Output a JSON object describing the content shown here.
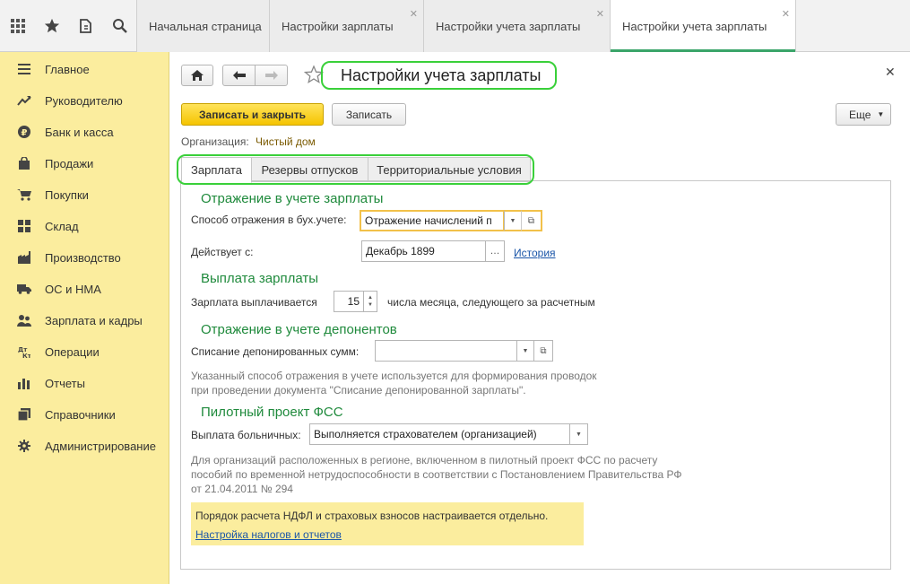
{
  "tabs": [
    {
      "label": "Начальная страница",
      "closable": false,
      "active": false
    },
    {
      "label": "Настройки зарплаты",
      "closable": true,
      "active": false
    },
    {
      "label": "Настройки учета зарплаты",
      "closable": true,
      "active": false
    },
    {
      "label": "Настройки учета зарплаты",
      "closable": true,
      "active": true
    }
  ],
  "sidebar": {
    "items": [
      {
        "label": "Главное",
        "icon": "menu-lines-icon"
      },
      {
        "label": "Руководителю",
        "icon": "trend-icon"
      },
      {
        "label": "Банк и касса",
        "icon": "ruble-coin-icon"
      },
      {
        "label": "Продажи",
        "icon": "shopping-bag-icon"
      },
      {
        "label": "Покупки",
        "icon": "cart-icon"
      },
      {
        "label": "Склад",
        "icon": "warehouse-icon"
      },
      {
        "label": "Производство",
        "icon": "factory-icon"
      },
      {
        "label": "ОС и НМА",
        "icon": "truck-icon"
      },
      {
        "label": "Зарплата и кадры",
        "icon": "people-icon"
      },
      {
        "label": "Операции",
        "icon": "debit-credit-icon"
      },
      {
        "label": "Отчеты",
        "icon": "bar-chart-icon"
      },
      {
        "label": "Справочники",
        "icon": "books-icon"
      },
      {
        "label": "Администрирование",
        "icon": "gear-icon"
      }
    ]
  },
  "form": {
    "title": "Настройки учета зарплаты",
    "save_close_label": "Записать и закрыть",
    "save_label": "Записать",
    "more_label": "Еще",
    "org_label": "Организация:",
    "org_value": "Чистый дом",
    "form_tabs": [
      "Зарплата",
      "Резервы отпусков",
      "Территориальные условия"
    ],
    "section_accounting": "Отражение в учете зарплаты",
    "method_label": "Способ отражения в бух.учете:",
    "method_value": "Отражение начислений п",
    "effective_label": "Действует с:",
    "effective_value": "Декабрь 1899",
    "history_link": "История",
    "section_payment": "Выплата зарплаты",
    "paid_label": "Зарплата выплачивается",
    "paid_day": "15",
    "paid_suffix": "числа месяца, следующего за расчетным",
    "section_deponents": "Отражение в учете депонентов",
    "writeoff_label": "Списание депонированных сумм:",
    "writeoff_value": "",
    "deponent_note_1": "Указанный способ отражения в учете используется для формирования проводок",
    "deponent_note_2": "при проведении документа \"Списание депонированной зарплаты\".",
    "section_fss": "Пилотный проект ФСС",
    "sick_label": "Выплата больничных:",
    "sick_value": "Выполняется страхователем (организацией)",
    "fss_note_1": "Для организаций расположенных в регионе, включенном в пилотный проект ФСС по расчету",
    "fss_note_2": "пособий по временной нетрудоспособности в соответствии с Постановлением Правительства РФ",
    "fss_note_3": "от 21.04.2011 № 294",
    "info_text": "Порядок расчета НДФЛ и страховых взносов настраивается отдельно.",
    "info_link": "Настройка налогов и отчетов"
  },
  "colors": {
    "accent_green": "#1f8a3c",
    "highlight_ring": "#3ad03a",
    "sidebar_bg": "#fbed9e",
    "primary_button": "#f5c400",
    "link": "#1a55a8"
  }
}
